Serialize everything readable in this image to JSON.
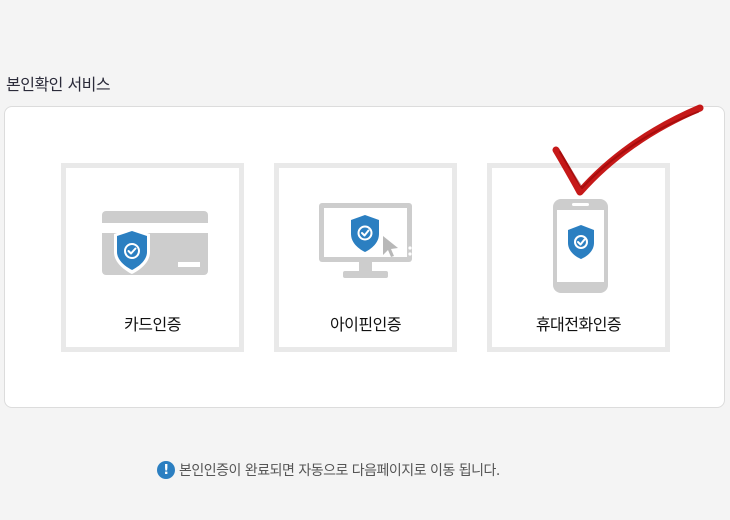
{
  "section": {
    "title": "본인확인 서비스"
  },
  "options": [
    {
      "label": "카드인증",
      "icon": "credit-card-shield-icon"
    },
    {
      "label": "아이핀인증",
      "icon": "monitor-shield-icon"
    },
    {
      "label": "휴대전화인증",
      "icon": "phone-shield-icon"
    }
  ],
  "notice": {
    "icon": "info-icon",
    "icon_glyph": "!",
    "text": "본인인증이 완료되면 자동으로 다음페이지로 이동 됩니다."
  },
  "colors": {
    "shield": "#2b7fc1",
    "device_gray": "#cdcdcd",
    "check_red": "#c00000"
  }
}
